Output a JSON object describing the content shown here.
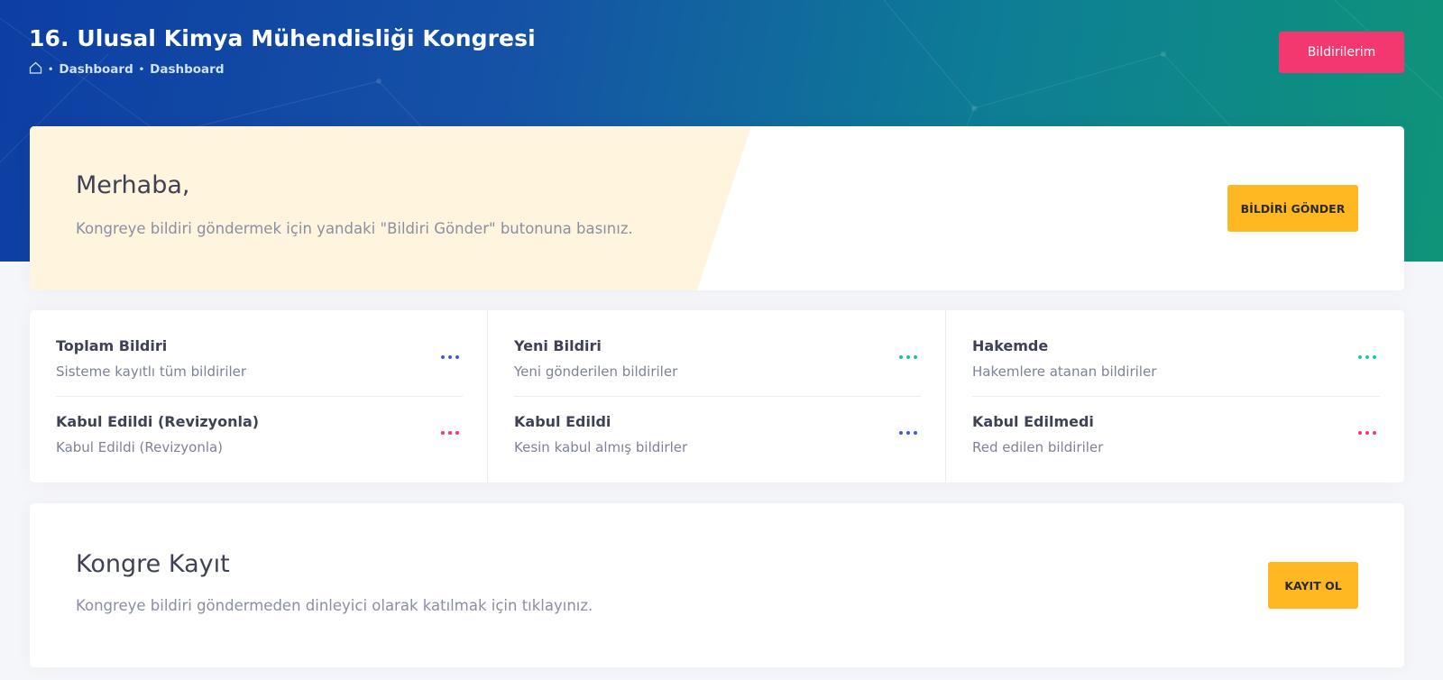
{
  "header": {
    "title": "16. Ulusal Kimya Mühendisliği Kongresi",
    "breadcrumb": [
      "Dashboard",
      "Dashboard"
    ],
    "my_submissions_label": "Bildirilerim"
  },
  "welcome": {
    "title": "Merhaba,",
    "text": "Kongreye bildiri göndermek için yandaki \"Bildiri Gönder\" butonuna basınız.",
    "button_label": "BİLDİRİ GÖNDER"
  },
  "stats": [
    {
      "items": [
        {
          "title": "Toplam Bildiri",
          "subtitle": "Sisteme kayıtlı tüm bildiriler",
          "dot_color": "#3b5bdb"
        },
        {
          "title": "Kabul Edildi (Revizyonla)",
          "subtitle": "Kabul Edildi (Revizyonla)",
          "dot_color": "#f2386e"
        }
      ]
    },
    {
      "items": [
        {
          "title": "Yeni Bildiri",
          "subtitle": "Yeni gönderilen bildiriler",
          "dot_color": "#1bc5a0"
        },
        {
          "title": "Kabul Edildi",
          "subtitle": "Kesin kabul almış bildirler",
          "dot_color": "#3b5bdb"
        }
      ]
    },
    {
      "items": [
        {
          "title": "Hakemde",
          "subtitle": "Hakemlere atanan bildiriler",
          "dot_color": "#1bc5bd"
        },
        {
          "title": "Kabul Edilmedi",
          "subtitle": "Red edilen bildiriler",
          "dot_color": "#f2386e"
        }
      ]
    }
  ],
  "register": {
    "title": "Kongre Kayıt",
    "text": "Kongreye bildiri göndermeden dinleyici olarak katılmak için tıklayınız.",
    "button_label": "KAYIT OL"
  },
  "colors": {
    "accent_pink": "#f2386e",
    "accent_yellow": "#ffb822",
    "welcome_tint": "#fff4de"
  },
  "icons": {
    "breadcrumb_home": "home-icon",
    "more": "more-dots-icon"
  }
}
